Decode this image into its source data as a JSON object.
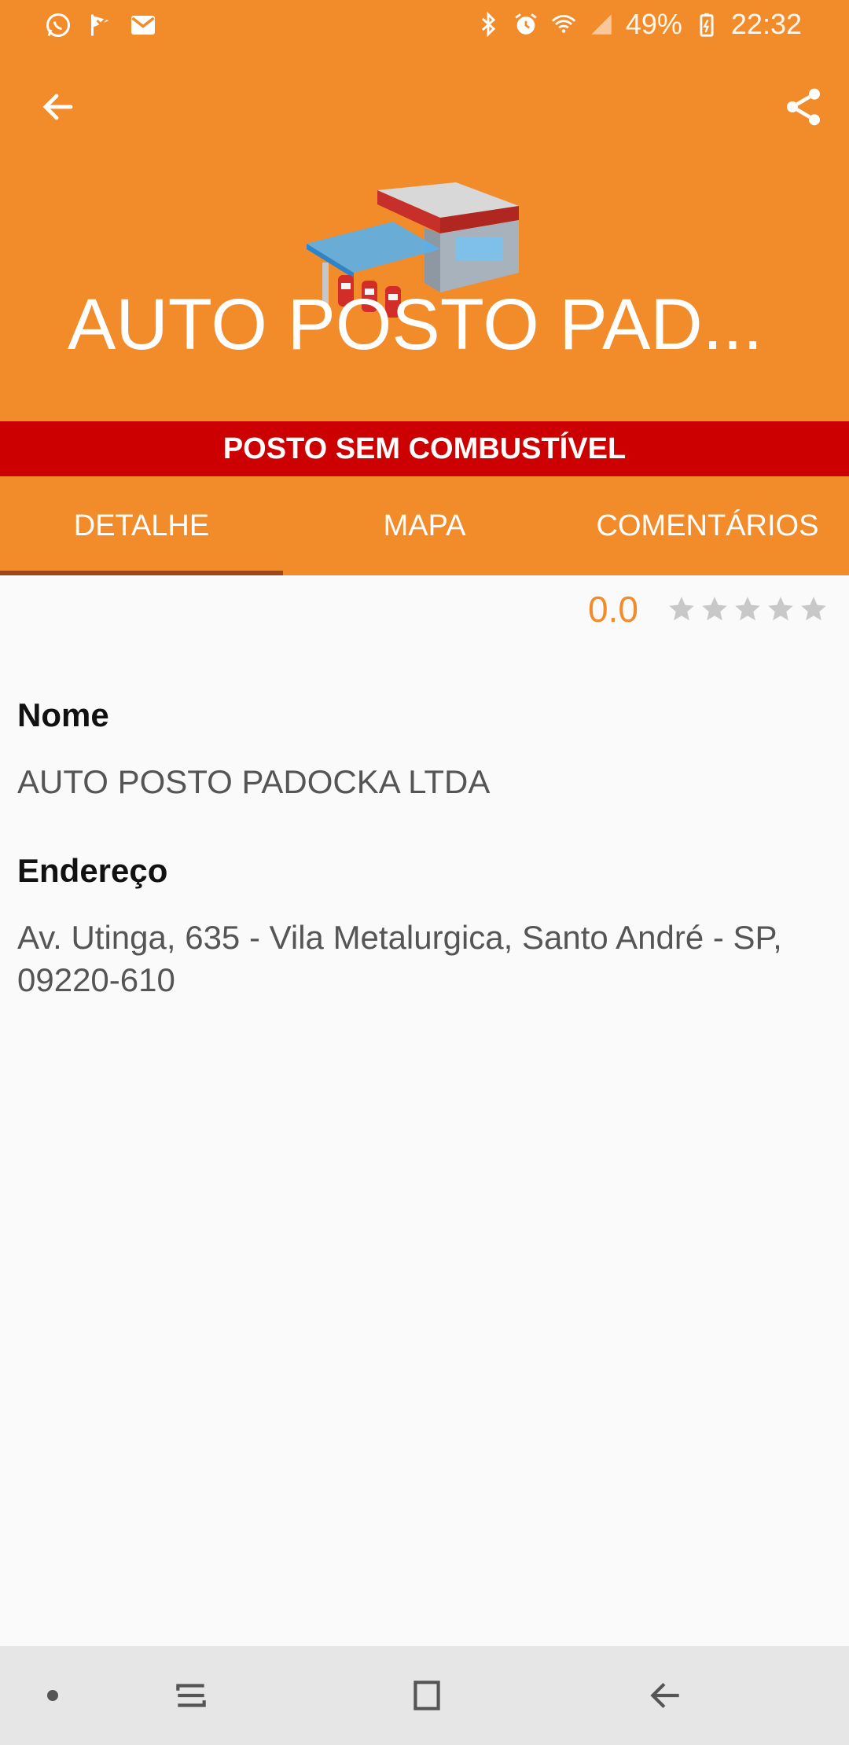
{
  "status_bar": {
    "battery": "49%",
    "time": "22:32",
    "left_icons": [
      "whatsapp-icon",
      "flag-icon",
      "gmail-icon"
    ],
    "right_icons": [
      "bluetooth-icon",
      "alarm-icon",
      "wifi-icon",
      "signal-icon",
      "battery-icon"
    ]
  },
  "toolbar": {
    "back_icon": "arrow-left-icon",
    "share_icon": "share-icon"
  },
  "header": {
    "title": "AUTO POSTO PAD...",
    "hero_icon": "gas-station-icon",
    "background_color": "#f28c2b"
  },
  "alert": {
    "text": "POSTO SEM COMBUSTÍVEL",
    "color": "#cc0000"
  },
  "tabs": [
    {
      "label": "DETALHE",
      "active": true
    },
    {
      "label": "MAPA",
      "active": false
    },
    {
      "label": "COMENTÁRIOS",
      "active": false
    }
  ],
  "rating": {
    "value": "0.0",
    "stars_total": 5,
    "stars_filled": 0
  },
  "details": {
    "name_label": "Nome",
    "name_value": "AUTO POSTO PADOCKA LTDA",
    "address_label": "Endereço",
    "address_line1": "Av. Utinga, 635 - Vila Metalurgica, Santo André - SP,",
    "address_line2": "09220-610"
  },
  "nav_bar": {
    "icons": [
      "dot-icon",
      "recents-icon",
      "home-icon",
      "back-icon"
    ]
  }
}
